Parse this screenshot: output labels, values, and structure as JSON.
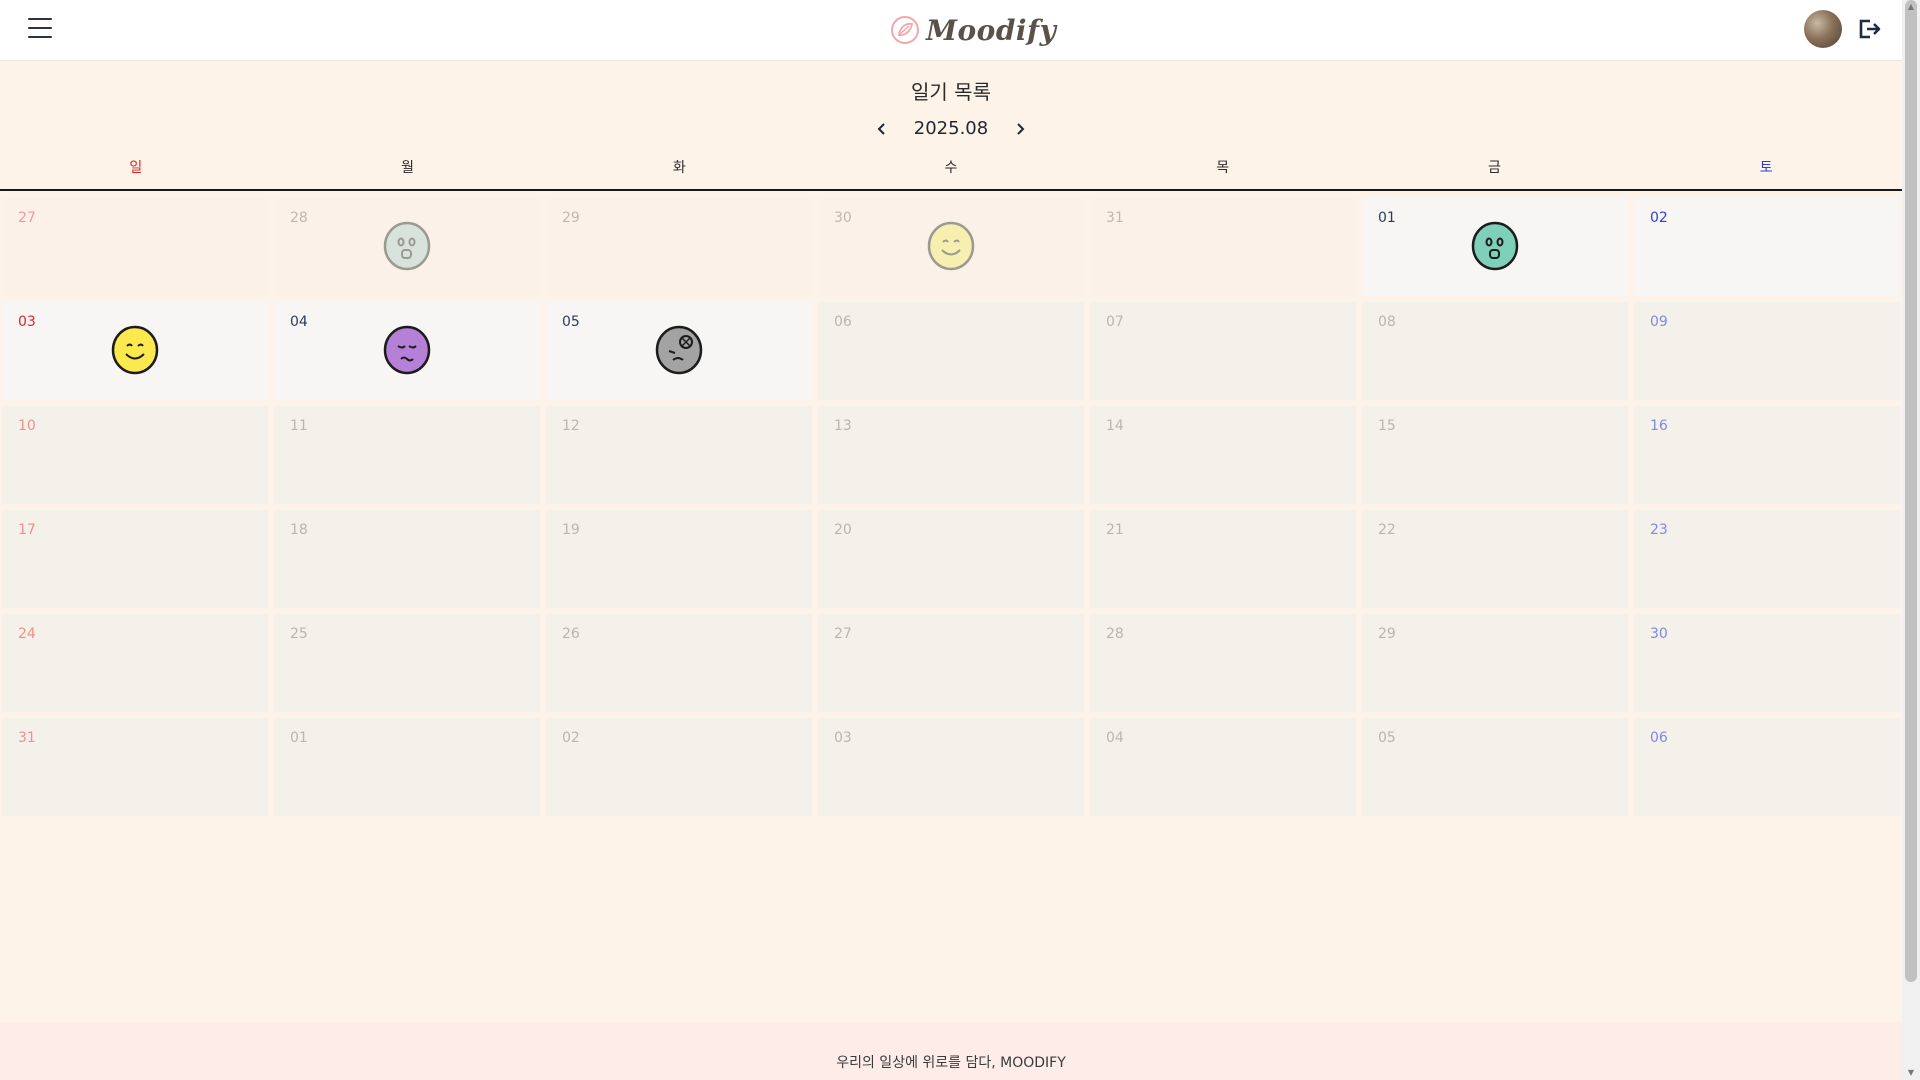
{
  "header": {
    "logo_text": "Moodify",
    "menu_icon": "hamburger-icon",
    "logout_icon": "logout-icon",
    "avatar": "user-avatar"
  },
  "page": {
    "title": "일기 목록",
    "month": "2025.08"
  },
  "weekdays": [
    "일",
    "월",
    "화",
    "수",
    "목",
    "금",
    "토"
  ],
  "colors": {
    "sunday": "#e02424",
    "saturday": "#2a3fd6",
    "accent": "#f2a8a8"
  },
  "calendar": {
    "days": [
      {
        "n": "27",
        "kind": "prev"
      },
      {
        "n": "28",
        "kind": "prev",
        "mood": "neutral-faded"
      },
      {
        "n": "29",
        "kind": "prev"
      },
      {
        "n": "30",
        "kind": "prev",
        "mood": "happy-faded"
      },
      {
        "n": "31",
        "kind": "prev"
      },
      {
        "n": "01",
        "kind": "cur",
        "mood": "surprised"
      },
      {
        "n": "02",
        "kind": "cur"
      },
      {
        "n": "03",
        "kind": "cur",
        "mood": "happy"
      },
      {
        "n": "04",
        "kind": "cur",
        "mood": "sad"
      },
      {
        "n": "05",
        "kind": "cur",
        "mood": "tired"
      },
      {
        "n": "06",
        "kind": "next"
      },
      {
        "n": "07",
        "kind": "next"
      },
      {
        "n": "08",
        "kind": "next"
      },
      {
        "n": "09",
        "kind": "next"
      },
      {
        "n": "10",
        "kind": "next"
      },
      {
        "n": "11",
        "kind": "next"
      },
      {
        "n": "12",
        "kind": "next"
      },
      {
        "n": "13",
        "kind": "next"
      },
      {
        "n": "14",
        "kind": "next"
      },
      {
        "n": "15",
        "kind": "next"
      },
      {
        "n": "16",
        "kind": "next"
      },
      {
        "n": "17",
        "kind": "next"
      },
      {
        "n": "18",
        "kind": "next"
      },
      {
        "n": "19",
        "kind": "next"
      },
      {
        "n": "20",
        "kind": "next"
      },
      {
        "n": "21",
        "kind": "next"
      },
      {
        "n": "22",
        "kind": "next"
      },
      {
        "n": "23",
        "kind": "next"
      },
      {
        "n": "24",
        "kind": "next"
      },
      {
        "n": "25",
        "kind": "next"
      },
      {
        "n": "26",
        "kind": "next"
      },
      {
        "n": "27",
        "kind": "next"
      },
      {
        "n": "28",
        "kind": "next"
      },
      {
        "n": "29",
        "kind": "next"
      },
      {
        "n": "30",
        "kind": "next"
      },
      {
        "n": "31",
        "kind": "next"
      },
      {
        "n": "01",
        "kind": "next"
      },
      {
        "n": "02",
        "kind": "next"
      },
      {
        "n": "03",
        "kind": "next"
      },
      {
        "n": "04",
        "kind": "next"
      },
      {
        "n": "05",
        "kind": "next"
      },
      {
        "n": "06",
        "kind": "next"
      }
    ],
    "mood_colors": {
      "neutral-faded": "#d8e3dc",
      "happy-faded": "#f7efb0",
      "surprised": "#7fd0b8",
      "happy": "#fbe94d",
      "sad": "#b67fd8",
      "tired": "#a3a3a3"
    }
  },
  "footer": {
    "text": "우리의 일상에 위로를 담다, MOODIFY"
  }
}
